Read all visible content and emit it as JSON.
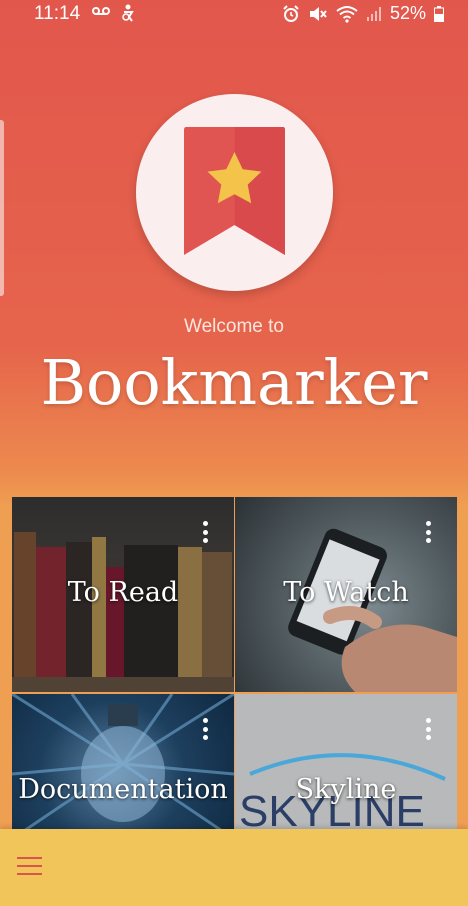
{
  "status_bar": {
    "time": "11:14",
    "battery_percent": "52%",
    "icons": [
      "voicemail-icon",
      "accessibility-icon",
      "alarm-icon",
      "mute-icon",
      "wifi-icon",
      "signal-icon",
      "battery-icon"
    ]
  },
  "header": {
    "welcome": "Welcome to",
    "app_title": "Bookmarker"
  },
  "tiles": [
    {
      "label": "To Read"
    },
    {
      "label": "To Watch"
    },
    {
      "label": "Documentation"
    },
    {
      "label": "Skyline"
    }
  ],
  "skyline_logo_text": "SKYLINE",
  "colors": {
    "gradient_top": "#e2574c",
    "gradient_bottom": "#ef9f52",
    "bottom_bar": "#f2c55b",
    "bookmark_red": "#e05552",
    "star_yellow": "#f3c34a"
  }
}
